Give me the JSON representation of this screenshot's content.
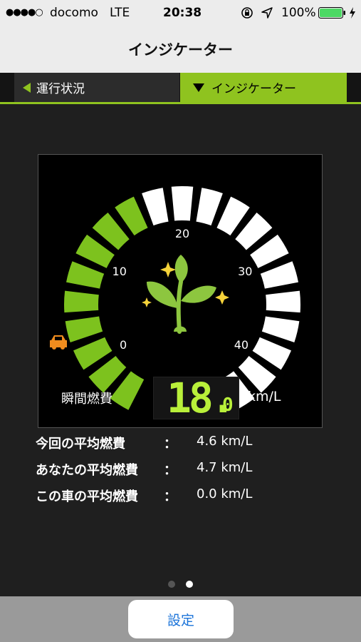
{
  "status_bar": {
    "signal_dots": "●●●●○",
    "carrier": "docomo",
    "network": "LTE",
    "time": "20:38",
    "battery_percent": "100%",
    "battery_level": 1.0,
    "battery_color": "#4cd964"
  },
  "nav": {
    "title": "インジケーター"
  },
  "tabs": [
    {
      "label": "運行状況",
      "selected": false
    },
    {
      "label": "インジケーター",
      "selected": true
    }
  ],
  "gauge": {
    "ticks": [
      "0",
      "10",
      "20",
      "30",
      "40"
    ],
    "value": 18.0,
    "max": 40,
    "segment_count": 21,
    "active_color": "#7dc21e",
    "inactive_color": "#ffffff",
    "icon": "plant-sparkle-icon",
    "car_icon": "car-icon",
    "car_icon_color": "#f08c1e"
  },
  "readout": {
    "label": "瞬間燃費",
    "value_main": "18.",
    "value_decimal": "0",
    "unit": "km/L"
  },
  "stats": [
    {
      "label": "今回の平均燃費",
      "colon": "：",
      "value": "4.6 km/L"
    },
    {
      "label": "あなたの平均燃費",
      "colon": "：",
      "value": "4.7 km/L"
    },
    {
      "label": "この車の平均燃費",
      "colon": "：",
      "value": "0.0 km/L"
    }
  ],
  "pager": {
    "pages": 2,
    "current": 2
  },
  "bottom": {
    "settings_label": "設定"
  }
}
